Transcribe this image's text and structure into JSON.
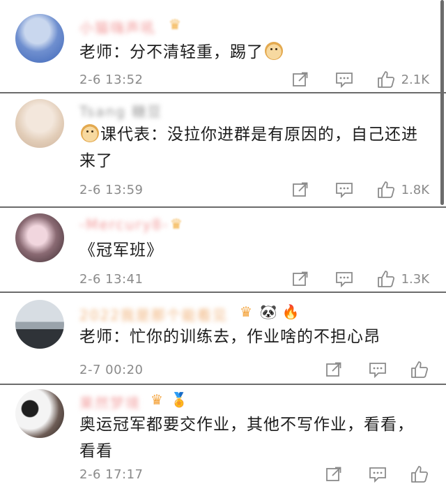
{
  "comments": [
    {
      "name": "小猫嗨声吼",
      "badges": [
        "crown"
      ],
      "text": "老师：分不清轻重，踢了",
      "emoji": "doge",
      "time": "2-6 13:52",
      "likes": "2.1K"
    },
    {
      "name": "Tsang 糖豆",
      "badges": [],
      "emoji_prefix": "doge",
      "text": "课代表：没拉你进群是有原因的，自己还进来了",
      "time": "2-6 13:59",
      "likes": "1.8K"
    },
    {
      "name": "-Mercury8-",
      "badges": [
        "crown"
      ],
      "text": "《冠军班》",
      "time": "2-6 13:41",
      "likes": "1.3K"
    },
    {
      "name": "2022我是那个能看见",
      "badges": [
        "crown-6",
        "panda",
        "fire"
      ],
      "text": "老师：忙你的训练去，作业啥的不担心昂",
      "time": "2-7 00:20",
      "likes": ""
    },
    {
      "name": "果然梦境",
      "badges": [
        "crown",
        "medal"
      ],
      "text": "奥运冠军都要交作业，其他不写作业，看看，看看",
      "time": "2-6 17:17",
      "likes": ""
    }
  ]
}
